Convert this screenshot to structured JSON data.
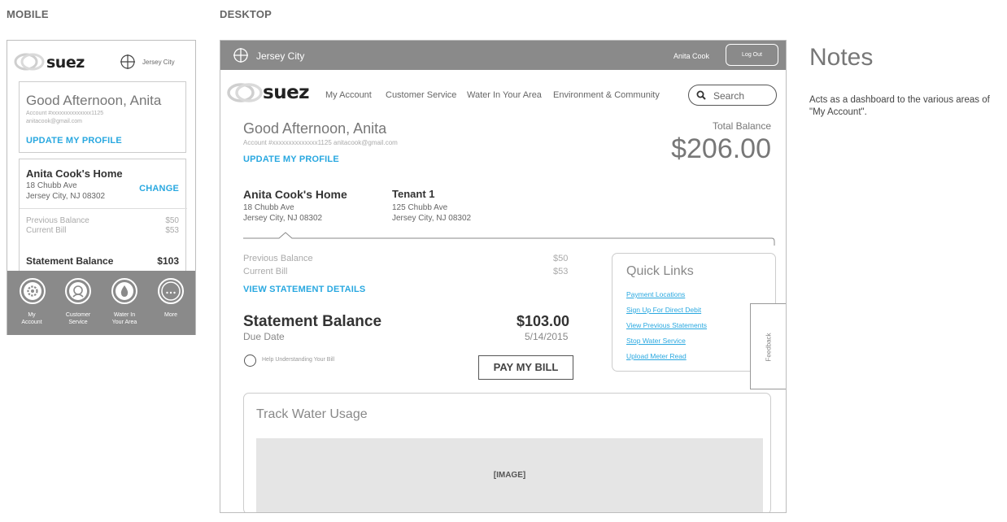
{
  "labels": {
    "mobile": "MOBILE",
    "desktop": "DESKTOP"
  },
  "mobile": {
    "location": "Jersey City",
    "greeting": "Good Afternoon, Anita",
    "account": "Account #xxxxxxxxxxxxxx1125",
    "email": "anitacook@gmail.com",
    "update_profile": "UPDATE MY PROFILE",
    "home_title": "Anita Cook's Home",
    "address1": "18 Chubb Ave",
    "address2": "Jersey City, NJ 08302",
    "change": "CHANGE",
    "prev_balance_label": "Previous Balance",
    "prev_balance_value": "$50",
    "current_bill_label": "Current Bill",
    "current_bill_value": "$53",
    "statement_label": "Statement Balance",
    "statement_value": "$103",
    "nav": [
      {
        "label1": "My",
        "label2": "Account",
        "icon": "gear-icon"
      },
      {
        "label1": "Customer",
        "label2": "Service",
        "icon": "person-icon"
      },
      {
        "label1": "Water In",
        "label2": "Your Area",
        "icon": "water-drop-icon"
      },
      {
        "label1": "More",
        "label2": "",
        "icon": "ellipsis-icon"
      }
    ]
  },
  "desktop": {
    "location": "Jersey City",
    "user_name": "Anita Cook",
    "logout": "Log Out",
    "nav": [
      "My Account",
      "Customer Service",
      "Water In Your Area",
      "Environment & Community"
    ],
    "search_placeholder": "Search",
    "greeting": "Good Afternoon, Anita",
    "account_line": "Account #xxxxxxxxxxxxxx1125  anitacook@gmail.com",
    "update_profile": "UPDATE MY PROFILE",
    "total_balance_label": "Total Balance",
    "total_balance_value": "$206.00",
    "home": {
      "title": "Anita Cook's Home",
      "address1": "18 Chubb Ave",
      "address2": "Jersey City, NJ 08302"
    },
    "tenant": {
      "title": "Tenant 1",
      "address1": "125 Chubb Ave",
      "address2": "Jersey City, NJ 08302"
    },
    "prev_balance_label": "Previous Balance",
    "prev_balance_value": "$50",
    "current_bill_label": "Current Bill",
    "current_bill_value": "$53",
    "view_statement": "VIEW STATEMENT DETAILS",
    "statement_label": "Statement Balance",
    "statement_value": "$103.00",
    "due_label": "Due Date",
    "due_value": "5/14/2015",
    "help_text": "Help Understanding Your Bill",
    "pay_button": "PAY MY BILL",
    "quick_links_title": "Quick Links",
    "quick_links": [
      "Payment Locations",
      "Sign Up For Direct Debit",
      "View Previous Statements",
      "Stop Water Service",
      "Upload Meter Read"
    ],
    "feedback": "Feedback",
    "track_title": "Track Water Usage",
    "image_placeholder": "[IMAGE]"
  },
  "notes": {
    "title": "Notes",
    "body": "Acts as a dashboard to the various areas of \"My Account\"."
  },
  "colors": {
    "accent": "#29a8e0",
    "header_gray": "#8a8a8a",
    "placeholder_gray": "#e5e5e5"
  }
}
